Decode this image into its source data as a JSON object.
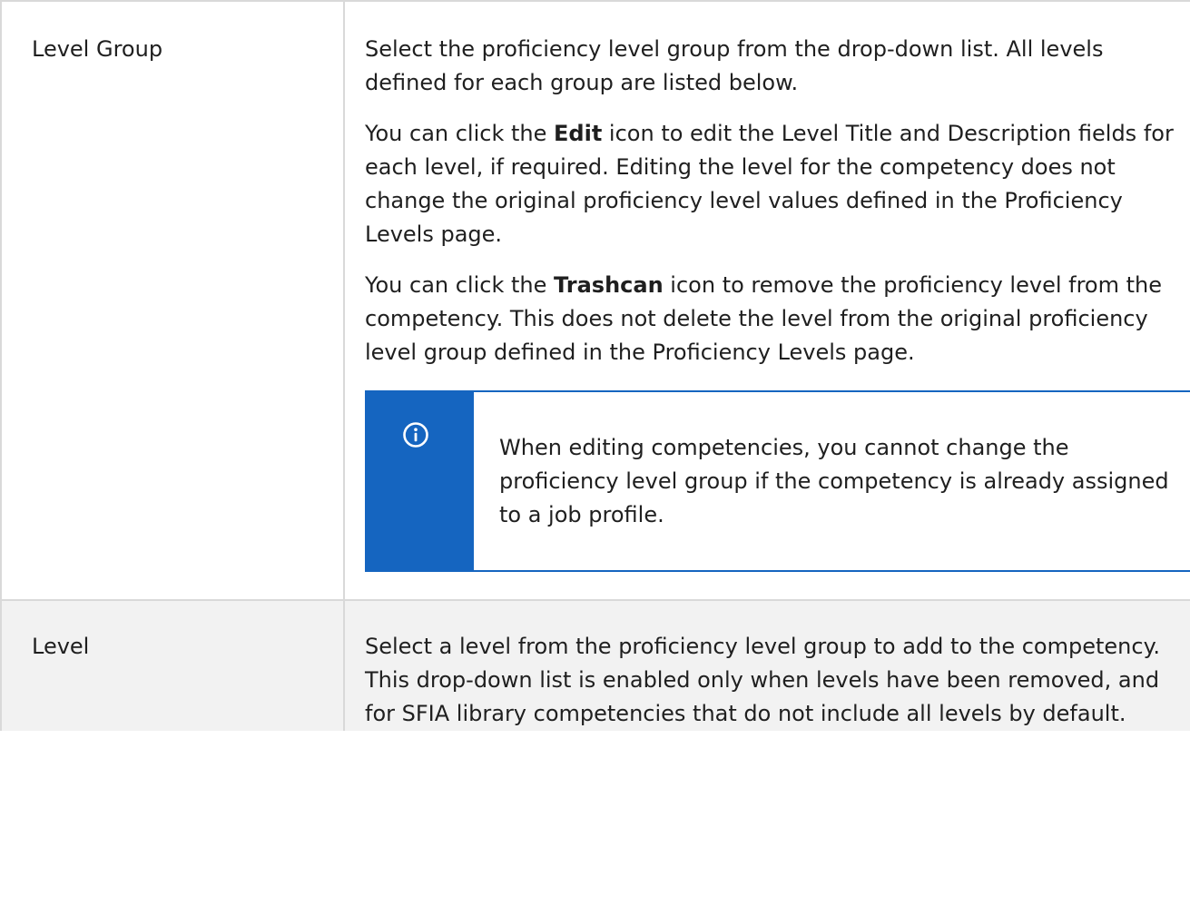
{
  "rows": [
    {
      "field": "Level Group",
      "paragraphs": [
        {
          "text": "Select the proficiency level group from the drop-down list. All levels defined for each group are listed below."
        },
        {
          "before": "You can click the ",
          "bold": "Edit",
          "after": " icon to edit the Level Title and Description fields for each level, if required. Editing the level for the competency does not change the original proficiency level values defined in the Proficiency Levels page."
        },
        {
          "before": "You can click the ",
          "bold": "Trashcan",
          "after": " icon to remove the proficiency level from the competency. This does not delete the level from the original proficiency level group defined in the Proficiency Levels page."
        }
      ],
      "note": {
        "icon": "info-icon",
        "text": "When editing competencies, you cannot change the proficiency level group if the competency is already assigned to a job profile."
      }
    },
    {
      "field": "Level",
      "paragraphs": [
        {
          "text": "Select a level from the proficiency level group to add to the competency. This drop-down list is enabled only when levels have been removed, and for SFIA library competencies that do not include all levels by default."
        }
      ]
    }
  ],
  "colors": {
    "note_accent": "#1565c0",
    "row_alt_background": "#f2f2f2",
    "border": "#d9d9d9"
  }
}
